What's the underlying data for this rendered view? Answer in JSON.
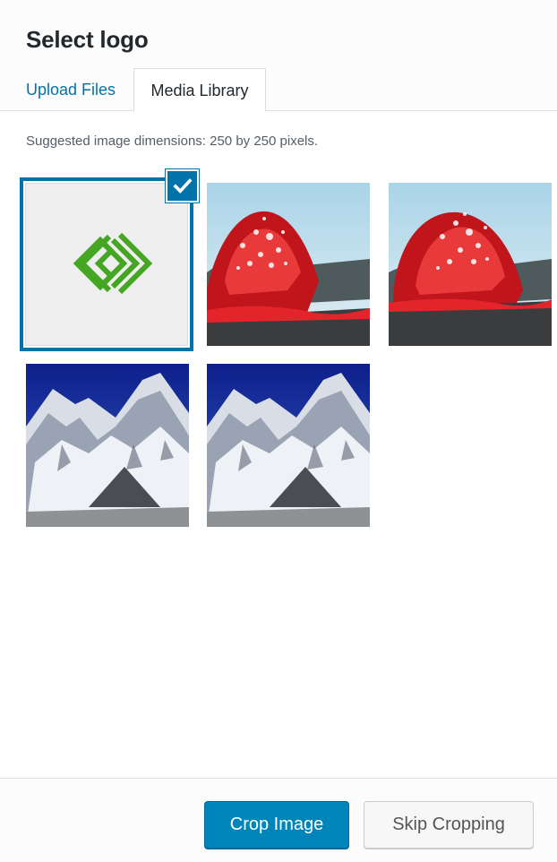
{
  "modal": {
    "title": "Select logo"
  },
  "tabs": [
    {
      "label": "Upload Files",
      "active": false
    },
    {
      "label": "Media Library",
      "active": true
    }
  ],
  "hint": "Suggested image dimensions: 250 by 250 pixels.",
  "media": [
    {
      "icon": "logo-diamonds-icon",
      "selected": true
    },
    {
      "icon": "lava-photo",
      "selected": false
    },
    {
      "icon": "lava-photo",
      "selected": false
    },
    {
      "icon": "mountain-photo",
      "selected": false
    },
    {
      "icon": "mountain-photo",
      "selected": false
    }
  ],
  "buttons": {
    "crop": "Crop Image",
    "skip": "Skip Cropping"
  },
  "colors": {
    "accent": "#0073aa",
    "primary_button": "#0085ba",
    "logo_green": "#44a623"
  }
}
